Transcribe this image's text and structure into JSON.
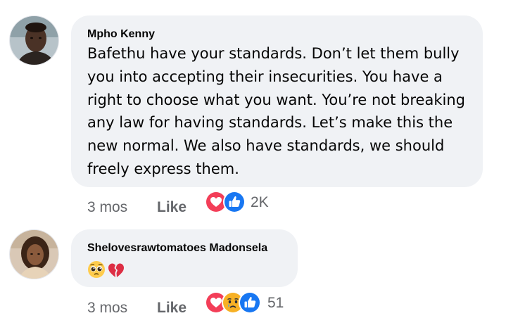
{
  "comments": [
    {
      "author": "Mpho Kenny",
      "text": "Bafethu have your standards. Don’t let them bully\nyou into accepting their insecurities. You have a\nright to choose what you want. You’re not breaking\nany law for having standards. Let’s make this the\nnew normal. We also have standards, we should\nfreely express them.",
      "time": "3 mos",
      "like_label": "Like",
      "reactions": [
        "love-icon",
        "like-icon"
      ],
      "reaction_count": "2K"
    },
    {
      "author": "Shelovesrawtomatoes Madonsela",
      "text_emojis": [
        "pleading-face-icon",
        "broken-heart-icon"
      ],
      "time": "3 mos",
      "like_label": "Like",
      "reactions": [
        "love-icon",
        "sad-icon",
        "like-icon"
      ],
      "reaction_count": "51"
    }
  ],
  "colors": {
    "bubble": "#f0f2f5",
    "meta": "#65676b",
    "love": "#f33e58",
    "like": "#1877f2",
    "sad": "#f7b125"
  }
}
